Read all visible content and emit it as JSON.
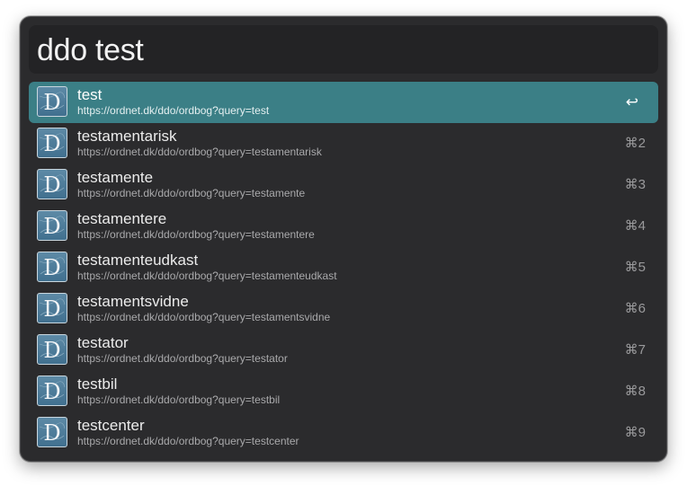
{
  "search": {
    "query": "ddo test"
  },
  "results": [
    {
      "title": "test",
      "subtitle": "https://ordnet.dk/ddo/ordbog?query=test",
      "shortcut": "↩",
      "selected": true
    },
    {
      "title": "testamentarisk",
      "subtitle": "https://ordnet.dk/ddo/ordbog?query=testamentarisk",
      "shortcut": "⌘2"
    },
    {
      "title": "testamente",
      "subtitle": "https://ordnet.dk/ddo/ordbog?query=testamente",
      "shortcut": "⌘3"
    },
    {
      "title": "testamentere",
      "subtitle": "https://ordnet.dk/ddo/ordbog?query=testamentere",
      "shortcut": "⌘4"
    },
    {
      "title": "testamenteudkast",
      "subtitle": "https://ordnet.dk/ddo/ordbog?query=testamenteudkast",
      "shortcut": "⌘5"
    },
    {
      "title": "testamentsvidne",
      "subtitle": "https://ordnet.dk/ddo/ordbog?query=testamentsvidne",
      "shortcut": "⌘6"
    },
    {
      "title": "testator",
      "subtitle": "https://ordnet.dk/ddo/ordbog?query=testator",
      "shortcut": "⌘7"
    },
    {
      "title": "testbil",
      "subtitle": "https://ordnet.dk/ddo/ordbog?query=testbil",
      "shortcut": "⌘8"
    },
    {
      "title": "testcenter",
      "subtitle": "https://ordnet.dk/ddo/ordbog?query=testcenter",
      "shortcut": "⌘9"
    }
  ],
  "icon": {
    "name": "ddo-dictionary-icon",
    "letter": "D"
  },
  "colors": {
    "window_bg": "#2b2b2d",
    "search_bg": "#232325",
    "selection": "#3b7f86",
    "text": "#ececec",
    "subtext": "#a9a9ab"
  }
}
